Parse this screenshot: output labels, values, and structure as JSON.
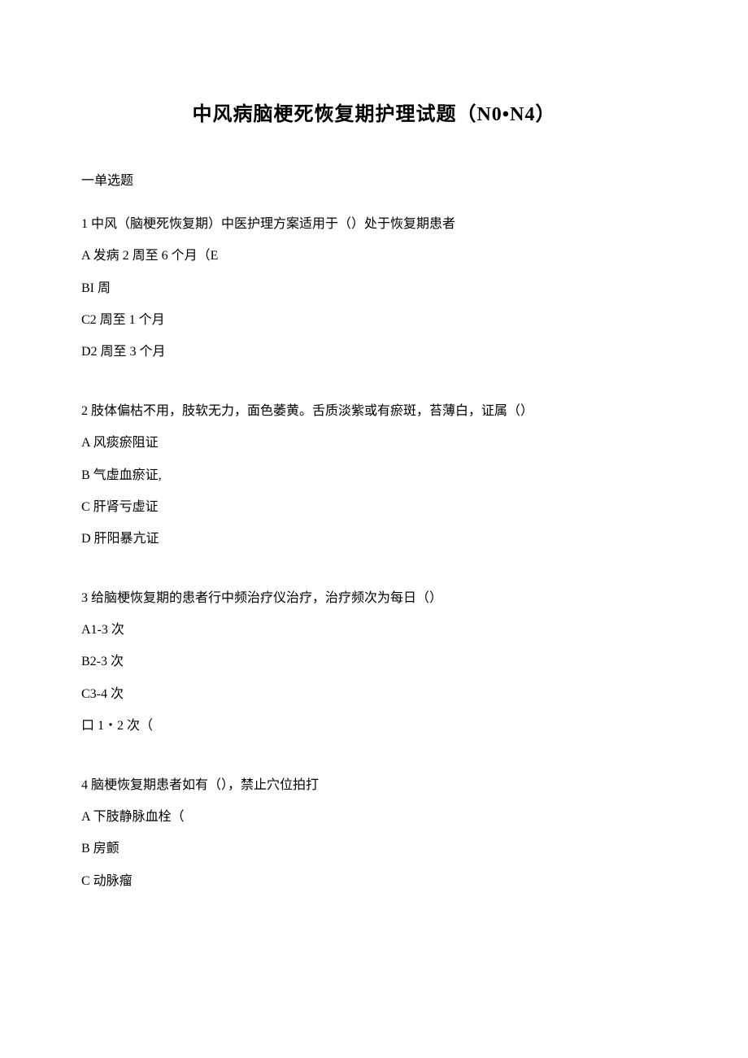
{
  "title": "中风病脑梗死恢复期护理试题（N0•N4）",
  "sectionHeader": "一单选题",
  "questions": [
    {
      "text": "1 中风（脑梗死恢复期）中医护理方案适用于（）处于恢复期患者",
      "options": [
        "A 发病 2 周至 6 个月（E",
        "BI 周",
        "C2 周至 1 个月",
        "D2 周至 3 个月"
      ]
    },
    {
      "text": "2 肢体偏枯不用，肢软无力，面色萎黄。舌质淡紫或有瘀斑，苔薄白，证属（）",
      "options": [
        "A 风痰瘀阻证",
        "B 气虚血瘀证,",
        "C 肝肾亏虚证",
        "D 肝阳暴亢证"
      ]
    },
    {
      "text": "3 给脑梗恢复期的患者行中频治疗仪治疗，治疗频次为每日（）",
      "options": [
        "A1-3 次",
        "B2-3 次",
        "C3-4 次",
        "口 1・2 次（"
      ]
    },
    {
      "text": "4 脑梗恢复期患者如有（），禁止穴位拍打",
      "options": [
        "A 下肢静脉血栓（",
        "B 房颤",
        "C 动脉瘤"
      ]
    }
  ]
}
